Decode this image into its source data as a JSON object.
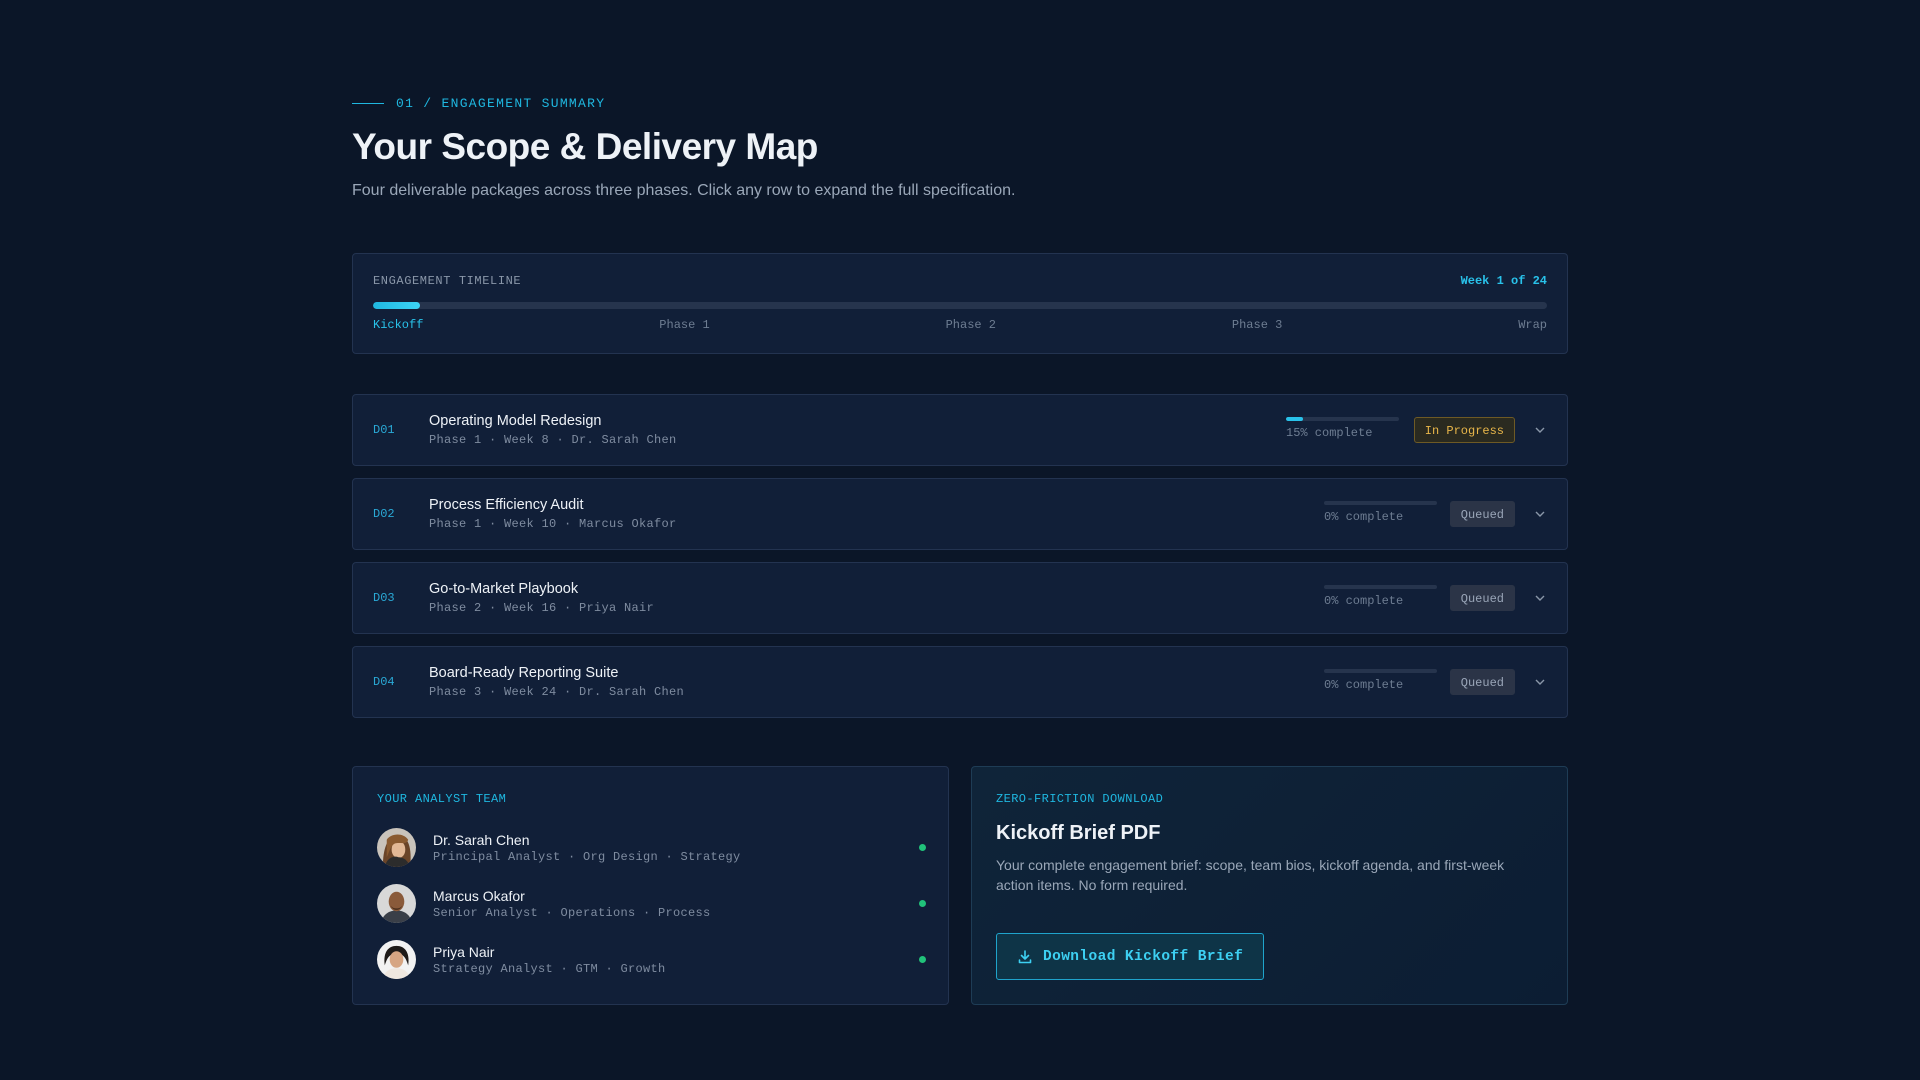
{
  "header": {
    "eyebrow": "01 / ENGAGEMENT SUMMARY",
    "title": "Your Scope & Delivery Map",
    "subtitle": "Four deliverable packages across three phases. Click any row to expand the full specification."
  },
  "timeline": {
    "label": "ENGAGEMENT TIMELINE",
    "week": "Week 1 of 24",
    "progress_fraction": 0.04,
    "phases": [
      "Kickoff",
      "Phase 1",
      "Phase 2",
      "Phase 3",
      "Wrap"
    ],
    "active_phase_index": 0
  },
  "deliverables": [
    {
      "code": "D01",
      "name": "Operating Model Redesign",
      "meta": "Phase 1 · Week 8 · Dr. Sarah Chen",
      "progress": 15,
      "progress_label": "15% complete",
      "status": "In Progress"
    },
    {
      "code": "D02",
      "name": "Process Efficiency Audit",
      "meta": "Phase 1 · Week 10 · Marcus Okafor",
      "progress": 0,
      "progress_label": "0% complete",
      "status": "Queued"
    },
    {
      "code": "D03",
      "name": "Go-to-Market Playbook",
      "meta": "Phase 2 · Week 16 · Priya Nair",
      "progress": 0,
      "progress_label": "0% complete",
      "status": "Queued"
    },
    {
      "code": "D04",
      "name": "Board-Ready Reporting Suite",
      "meta": "Phase 3 · Week 24 · Dr. Sarah Chen",
      "progress": 0,
      "progress_label": "0% complete",
      "status": "Queued"
    }
  ],
  "team": {
    "label": "YOUR ANALYST TEAM",
    "members": [
      {
        "name": "Dr. Sarah Chen",
        "role": "Principal Analyst · Org Design · Strategy",
        "avatar": "avatar-sarah"
      },
      {
        "name": "Marcus Okafor",
        "role": "Senior Analyst · Operations · Process",
        "avatar": "avatar-marcus"
      },
      {
        "name": "Priya Nair",
        "role": "Strategy Analyst · GTM · Growth",
        "avatar": "avatar-priya"
      }
    ]
  },
  "download": {
    "label": "ZERO-FRICTION DOWNLOAD",
    "title": "Kickoff Brief PDF",
    "description": "Your complete engagement brief: scope, team bios, kickoff agenda, and first-week action items. No form required.",
    "button_label": "Download Kickoff Brief",
    "button_icon": "download-icon"
  },
  "colors": {
    "background": "#0b1628",
    "accent": "#1fb7e0",
    "in_progress": "#e8b64a",
    "online": "#21c27a"
  }
}
